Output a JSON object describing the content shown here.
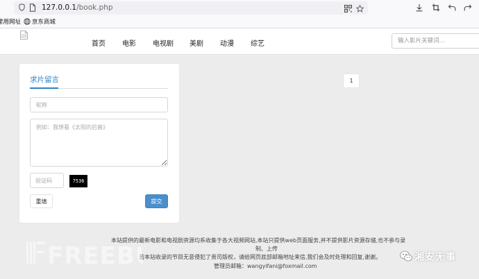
{
  "browser": {
    "url_host": "127.0.0.1",
    "url_path": "/book.php",
    "bookmarks": [
      {
        "label": "常用网址"
      },
      {
        "label": "京东商城"
      }
    ]
  },
  "site": {
    "nav": [
      {
        "label": "首页"
      },
      {
        "label": "电影"
      },
      {
        "label": "电视剧"
      },
      {
        "label": "美剧"
      },
      {
        "label": "动漫"
      },
      {
        "label": "综艺"
      }
    ],
    "search_placeholder": "输入影片关键词..."
  },
  "form": {
    "title": "求片留言",
    "nickname_placeholder": "昵称",
    "message_placeholder": "例如：我想看《太阳的后裔》",
    "captcha_placeholder": "验证码",
    "captcha_code": "7536",
    "reset_label": "重填",
    "submit_label": "提交"
  },
  "pagination": {
    "current_page": "1"
  },
  "footer": {
    "line1": "本站提供的最新电影和电视剧资源均系收集于各大视频网站,本站只提供web页面服务,并不提供影片资源存储,也不参与录",
    "line2": "制、上传",
    "line3": "若本站收录的节目无意侵犯了贵司版权，请给网页底部邮箱地址来信,我们会及时处理和回复,谢谢。",
    "line4": "管理员邮箱：wangyifani@foxmail.com"
  },
  "watermarks": {
    "left": "FREEBUF",
    "right": "湘安无事"
  }
}
